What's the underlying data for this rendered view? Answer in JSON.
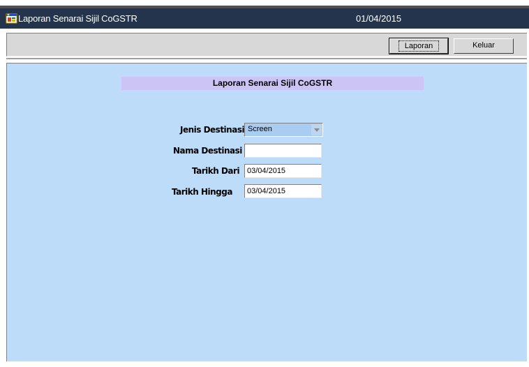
{
  "window": {
    "title": "Laporan Senarai Sijil CoGSTR",
    "date": "01/04/2015"
  },
  "toolbar": {
    "laporan_label": "Laporan",
    "keluar_label": "Keluar"
  },
  "form": {
    "heading": "Laporan Senarai Sijil CoGSTR",
    "jenis_destinasi": {
      "label": "Jenis Destinasi",
      "value": "Screen"
    },
    "nama_destinasi": {
      "label": "Nama Destinasi",
      "value": ""
    },
    "tarikh_dari": {
      "label": "Tarikh Dari",
      "value": "03/04/2015"
    },
    "tarikh_hingga": {
      "label": "Tarikh Hingga",
      "value": "03/04/2015"
    }
  },
  "colors": {
    "titlebar": "#24344c",
    "panel": "#bcdcfa",
    "heading": "#ccc4f4",
    "combo": "#a9ccf3"
  },
  "icons": {
    "app": "app-window-icon",
    "dropdown": "chevron-down-icon"
  }
}
